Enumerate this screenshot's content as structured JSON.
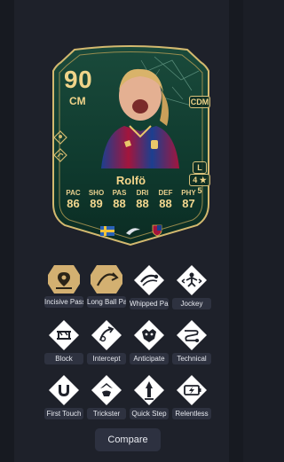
{
  "card": {
    "rating": "90",
    "position": "CM",
    "alt_position": "CDM",
    "name": "Rolfö",
    "preferred_foot": "L",
    "skill_weak": "4 ★ 5",
    "stats": [
      {
        "label": "PAC",
        "value": "86"
      },
      {
        "label": "SHO",
        "value": "89"
      },
      {
        "label": "PAS",
        "value": "88"
      },
      {
        "label": "DRI",
        "value": "88"
      },
      {
        "label": "DEF",
        "value": "88"
      },
      {
        "label": "PHY",
        "value": "87"
      }
    ],
    "flags": [
      "sweden-flag-icon",
      "league-badge-icon",
      "club-badge-icon"
    ],
    "colors": {
      "card_bg": "#0f3a2e",
      "accent_gold": "#f0d48a",
      "frame": "#d3b96f"
    }
  },
  "playstyles": [
    {
      "label": "Incisive Pass",
      "icon": "incisive-pass-icon",
      "plus": true
    },
    {
      "label": "Long Ball Pass",
      "icon": "long-ball-pass-icon",
      "plus": true
    },
    {
      "label": "Whipped Pass",
      "icon": "whipped-pass-icon",
      "plus": false
    },
    {
      "label": "Jockey",
      "icon": "jockey-icon",
      "plus": false
    },
    {
      "label": "Block",
      "icon": "block-icon",
      "plus": false
    },
    {
      "label": "Intercept",
      "icon": "intercept-icon",
      "plus": false
    },
    {
      "label": "Anticipate",
      "icon": "anticipate-icon",
      "plus": false
    },
    {
      "label": "Technical",
      "icon": "technical-icon",
      "plus": false
    },
    {
      "label": "First Touch",
      "icon": "first-touch-icon",
      "plus": false
    },
    {
      "label": "Trickster",
      "icon": "trickster-icon",
      "plus": false
    },
    {
      "label": "Quick Step",
      "icon": "quick-step-icon",
      "plus": false
    },
    {
      "label": "Relentless",
      "icon": "relentless-icon",
      "plus": false
    }
  ],
  "actions": {
    "compare_label": "Compare"
  }
}
